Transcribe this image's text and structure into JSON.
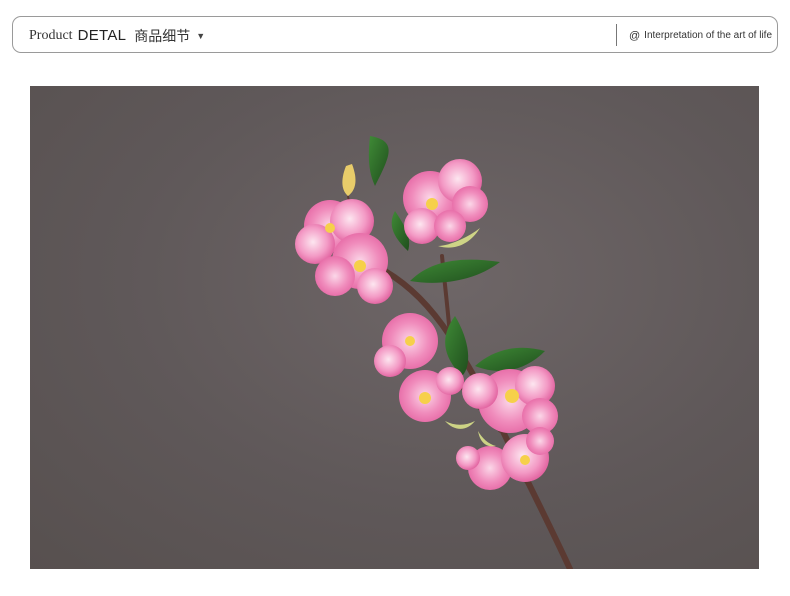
{
  "header": {
    "title_product": "Product",
    "title_detal": "DETAL",
    "title_cn": "商品细节",
    "caret_icon": "▼",
    "caret_icon_name": "caret-down-icon",
    "at_icon": "@",
    "at_icon_name": "at-icon",
    "tagline": "Interpretation of the art of life"
  },
  "colors": {
    "background_wall": "#5f5859",
    "petal_pink": "#f07fb4",
    "leaf_green": "#2f6b2a",
    "branch_brown": "#5b3a32",
    "header_border": "#9a9a9a"
  },
  "photo": {
    "subject": "pink-blossom-branch-photo"
  }
}
